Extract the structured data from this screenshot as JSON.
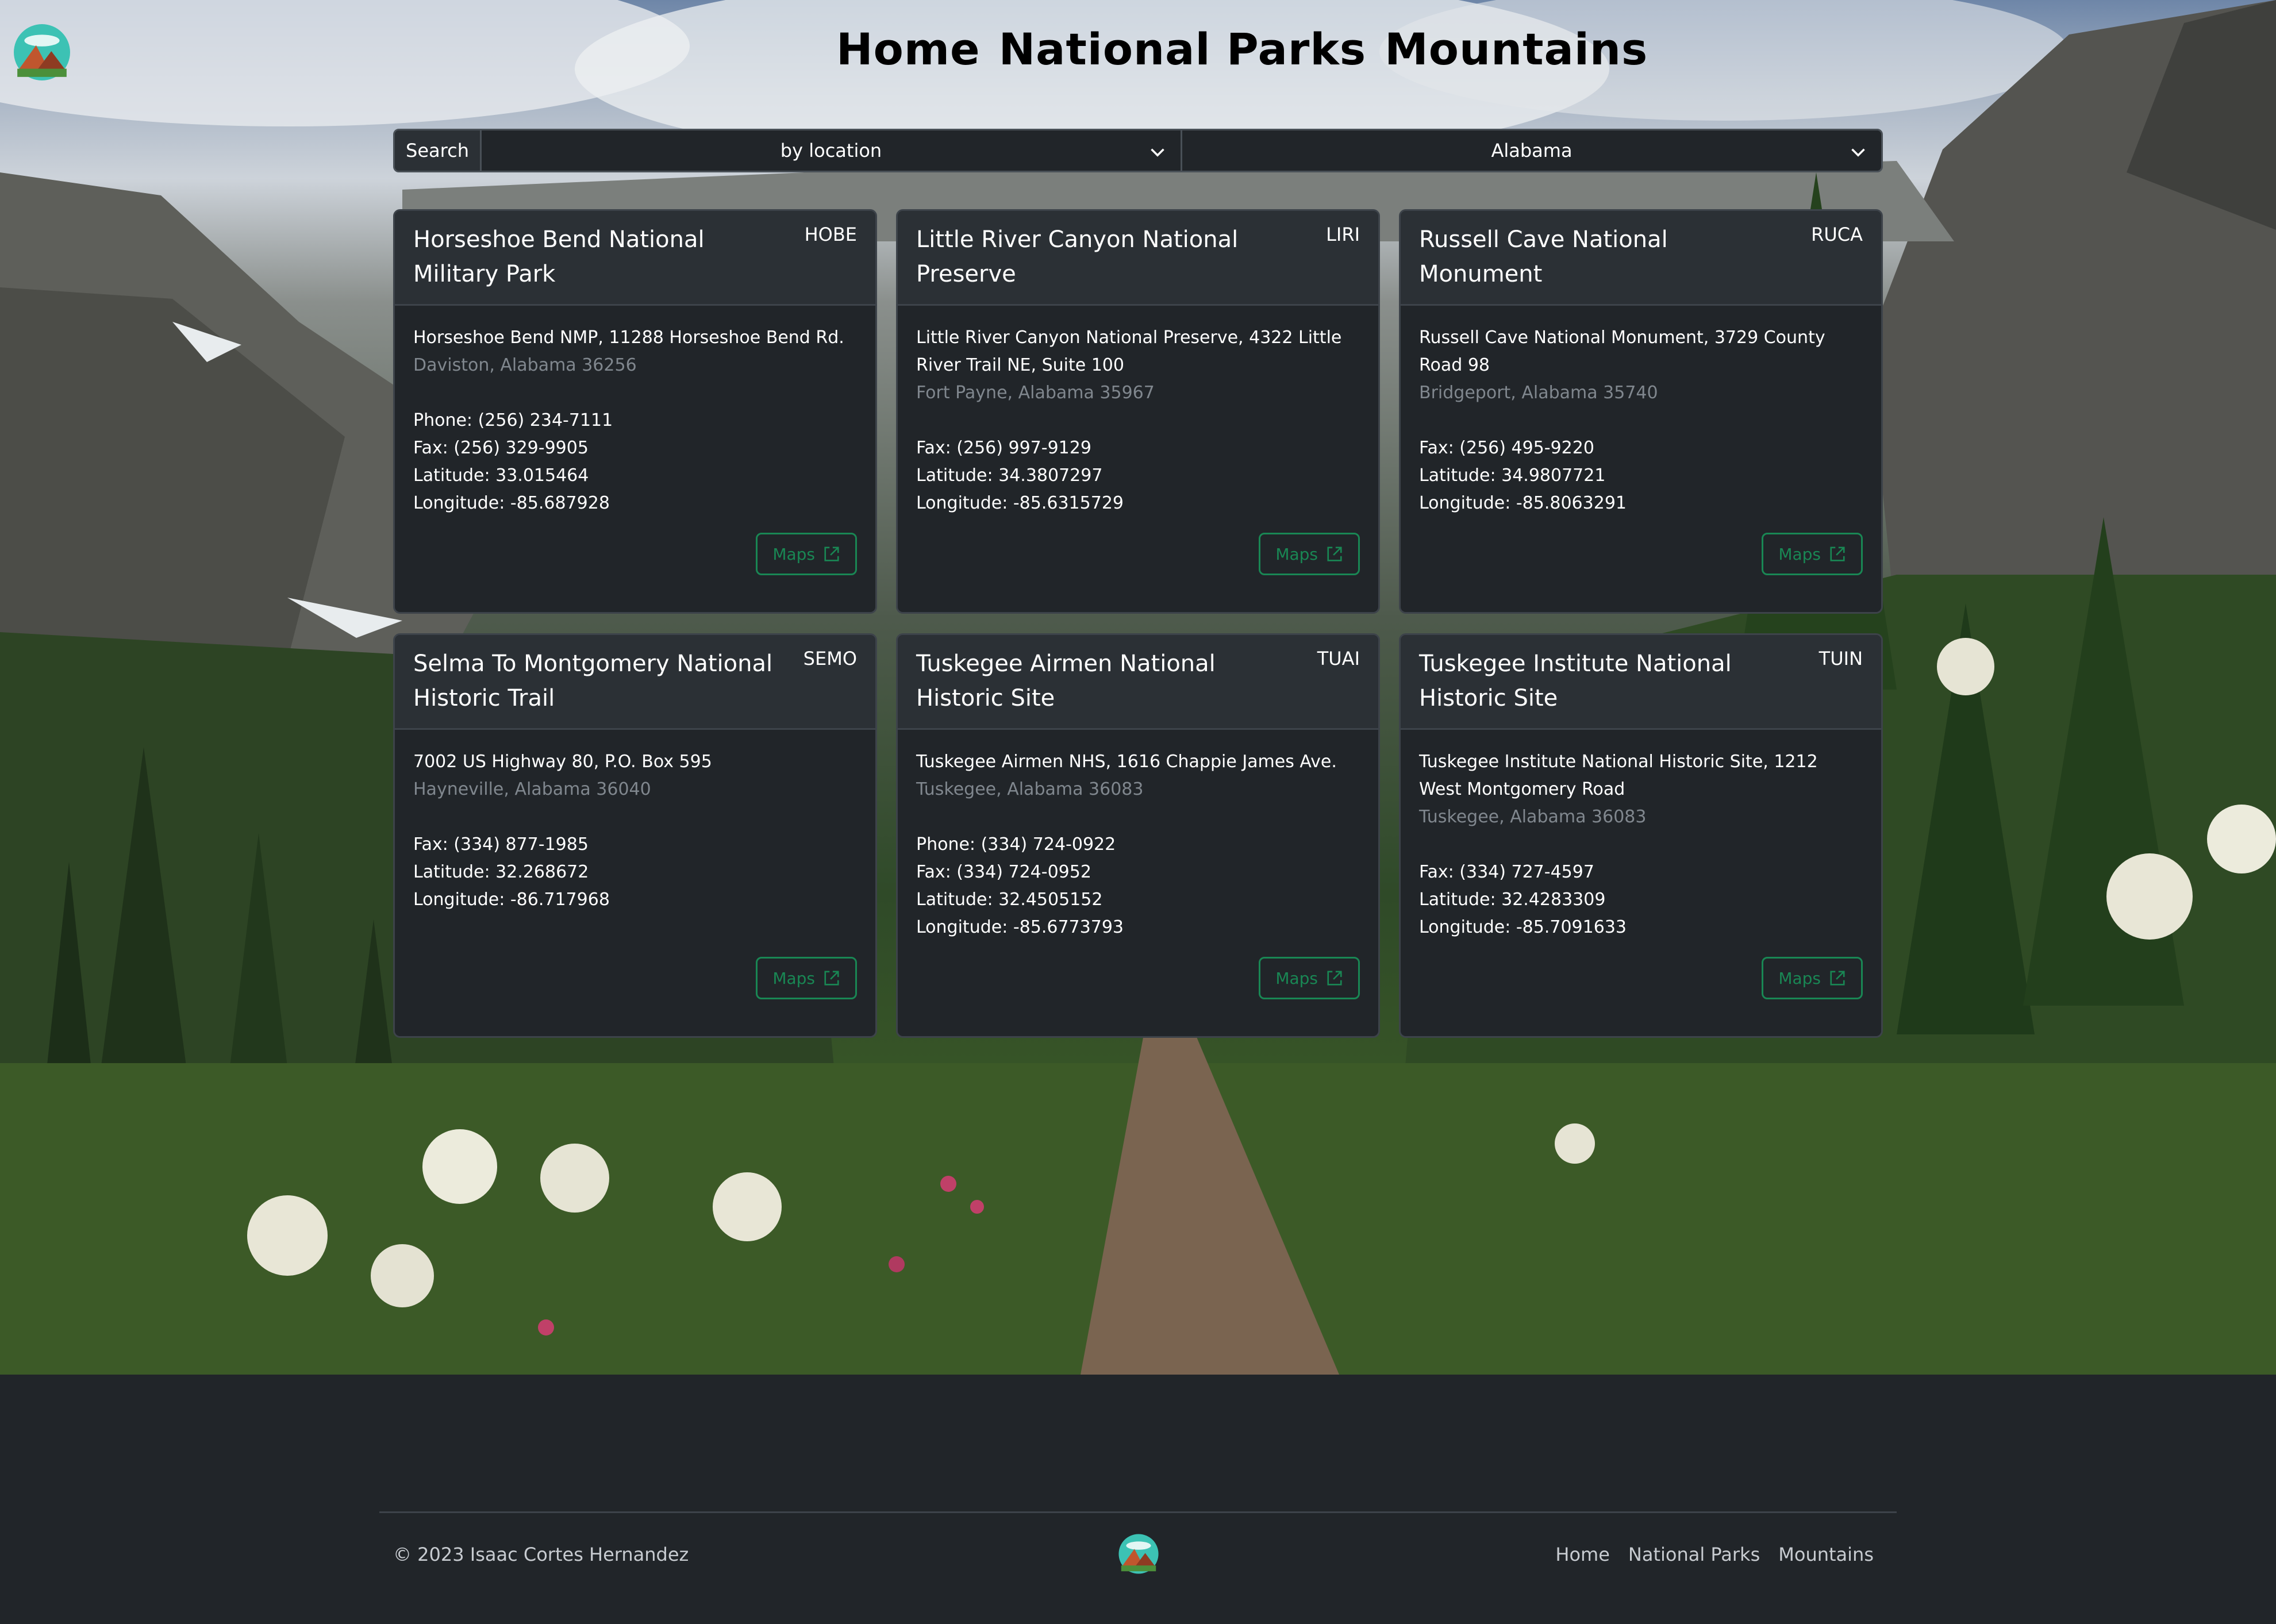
{
  "nav": {
    "home": "Home",
    "parks": "National Parks",
    "mountains": "Mountains"
  },
  "search": {
    "label": "Search",
    "mode": "by location",
    "state": "Alabama"
  },
  "cards": [
    {
      "title": "Horseshoe Bend National Military Park",
      "code": "HOBE",
      "address": "Horseshoe Bend NMP, 11288 Horseshoe Bend Rd.",
      "city": "Daviston, Alabama 36256",
      "phone": "Phone: (256) 234-7111",
      "fax": "Fax: (256) 329-9905",
      "lat": "Latitude: 33.015464",
      "lon": "Longitude: -85.687928",
      "maps": "Maps"
    },
    {
      "title": "Little River Canyon National Preserve",
      "code": "LIRI",
      "address": "Little River Canyon National Preserve, 4322 Little River Trail NE, Suite 100",
      "city": "Fort Payne, Alabama 35967",
      "fax": "Fax: (256) 997-9129",
      "lat": "Latitude: 34.3807297",
      "lon": "Longitude: -85.6315729",
      "maps": "Maps"
    },
    {
      "title": "Russell Cave National Monument",
      "code": "RUCA",
      "address": "Russell Cave National Monument, 3729 County Road 98",
      "city": "Bridgeport, Alabama 35740",
      "fax": "Fax: (256) 495-9220",
      "lat": "Latitude: 34.9807721",
      "lon": "Longitude: -85.8063291",
      "maps": "Maps"
    },
    {
      "title": "Selma To Montgomery National Historic Trail",
      "code": "SEMO",
      "address": "7002 US Highway 80, P.O. Box 595",
      "city": "Hayneville, Alabama 36040",
      "fax": "Fax: (334) 877-1985",
      "lat": "Latitude: 32.268672",
      "lon": "Longitude: -86.717968",
      "maps": "Maps"
    },
    {
      "title": "Tuskegee Airmen National Historic Site",
      "code": "TUAI",
      "address": "Tuskegee Airmen NHS, 1616 Chappie James Ave.",
      "city": "Tuskegee, Alabama 36083",
      "phone": "Phone: (334) 724-0922",
      "fax": "Fax: (334) 724-0952",
      "lat": "Latitude: 32.4505152",
      "lon": "Longitude: -85.6773793",
      "maps": "Maps"
    },
    {
      "title": "Tuskegee Institute National Historic Site",
      "code": "TUIN",
      "address": "Tuskegee Institute National Historic Site, 1212 West Montgomery Road",
      "city": "Tuskegee, Alabama 36083",
      "fax": "Fax: (334) 727-4597",
      "lat": "Latitude: 32.4283309",
      "lon": "Longitude: -85.7091633",
      "maps": "Maps"
    }
  ],
  "footer": {
    "copyright": "© 2023 Isaac Cortes Hernandez",
    "home": "Home",
    "parks": "National Parks",
    "mountains": "Mountains"
  },
  "colors": {
    "accent": "#198754",
    "card_bg": "#212529",
    "page_bg": "#212529",
    "muted": "#80878e"
  },
  "icons": {
    "logo": "mountain-logo-icon",
    "chevron": "chevron-down-icon",
    "external": "external-link-icon"
  }
}
